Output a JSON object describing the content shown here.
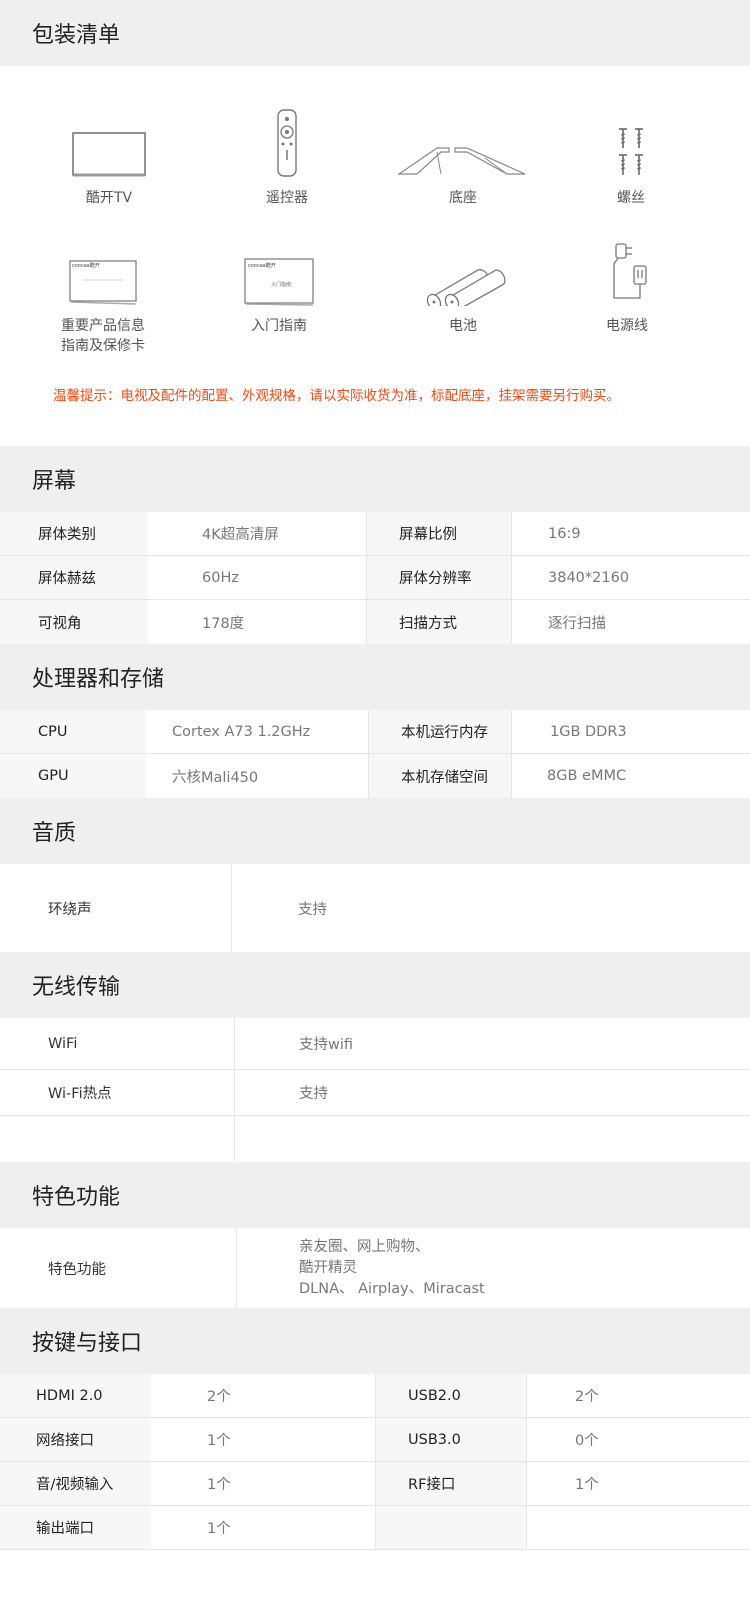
{
  "package": {
    "title": "包装清单",
    "items": [
      {
        "label": "酷开TV",
        "icon": "tv-icon"
      },
      {
        "label": "遥控器",
        "icon": "remote-icon"
      },
      {
        "label": "底座",
        "icon": "stand-icon"
      },
      {
        "label": "螺丝",
        "icon": "screws-icon"
      },
      {
        "label": "重要产品信息\n指南及保修卡",
        "label_line1": "重要产品信息",
        "label_line2": "指南及保修卡",
        "icon": "card-icon",
        "card_brand": "coocaa酷开"
      },
      {
        "label": "入门指南",
        "icon": "guide-icon",
        "card_brand": "coocaa酷开",
        "card_text": "入门指南"
      },
      {
        "label": "电池",
        "icon": "battery-icon"
      },
      {
        "label": "电源线",
        "icon": "power-cord-icon"
      }
    ],
    "notice": "温馨提示：电视及配件的配置、外观规格，请以实际收货为准，标配底座，挂架需要另行购买。"
  },
  "screen": {
    "title": "屏幕",
    "rows": [
      [
        "屏体类别",
        "4K超高清屏",
        "屏幕比例",
        "16:9"
      ],
      [
        "屏体赫兹",
        "60Hz",
        "屏体分辨率",
        "3840*2160"
      ],
      [
        "可视角",
        "178度",
        "扫描方式",
        "逐行扫描"
      ]
    ]
  },
  "cpu": {
    "title": "处理器和存储",
    "rows": [
      [
        "CPU",
        "Cortex A73 1.2GHz",
        "本机运行内存",
        "1GB DDR3"
      ],
      [
        "GPU",
        "六核Mali450",
        "本机存储空间",
        "8GB eMMC"
      ]
    ]
  },
  "audio": {
    "title": "音质",
    "rows": [
      [
        "环绕声",
        "支持"
      ]
    ]
  },
  "wireless": {
    "title": "无线传输",
    "rows": [
      [
        "WiFi",
        "支持wifi"
      ],
      [
        "Wi-Fi热点",
        "支持"
      ],
      [
        "",
        ""
      ]
    ]
  },
  "features": {
    "title": "特色功能",
    "key": "特色功能",
    "lines": [
      "亲友圈、网上购物、",
      "酷开精灵",
      "DLNA、 Airplay、Miracast"
    ]
  },
  "ports": {
    "title": "按键与接口",
    "rows": [
      [
        "HDMI 2.0",
        "2个",
        "USB2.0",
        "2个"
      ],
      [
        "网络接口",
        "1个",
        "USB3.0",
        "0个"
      ],
      [
        "音/视频输入",
        "1个",
        "RF接口",
        "1个"
      ],
      [
        "输出端口",
        "1个",
        "",
        ""
      ]
    ]
  },
  "colors": {
    "accent": "#f04a14",
    "header_bg": "#efefef",
    "key_bg": "#f7f7f7"
  }
}
